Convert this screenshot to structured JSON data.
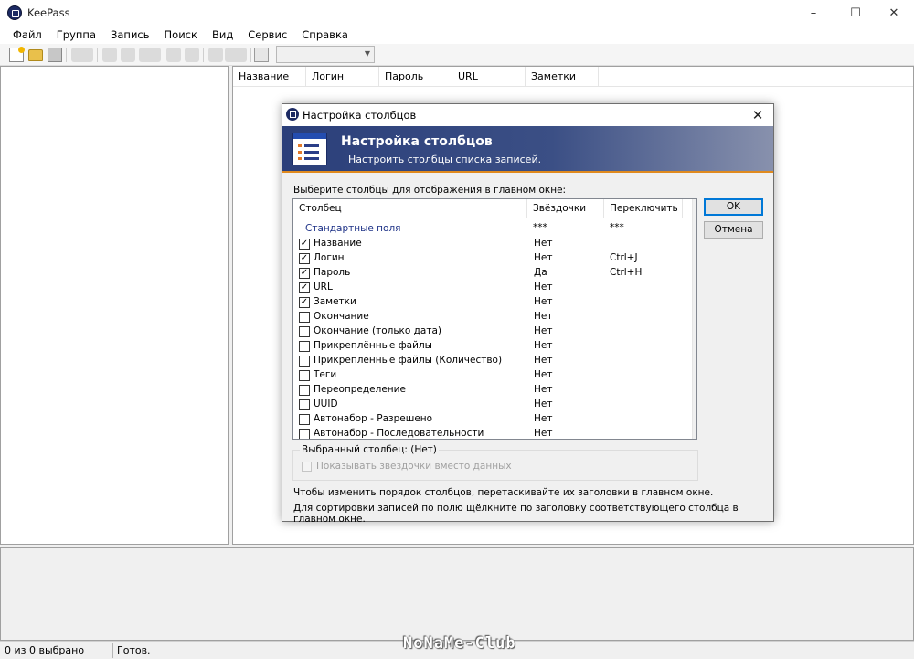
{
  "window": {
    "title": "KeePass"
  },
  "menu": [
    "Файл",
    "Группа",
    "Запись",
    "Поиск",
    "Вид",
    "Сервис",
    "Справка"
  ],
  "list_columns": [
    "Название",
    "Логин",
    "Пароль",
    "URL",
    "Заметки"
  ],
  "status": {
    "selection": "0 из 0 выбрано",
    "state": "Готов."
  },
  "watermark": "NoNaMe-Club",
  "dialog": {
    "title": "Настройка столбцов",
    "banner_title": "Настройка столбцов",
    "banner_subtitle": "Настроить столбцы списка записей.",
    "label": "Выберите столбцы для отображения в главном окне:",
    "headers": {
      "column": "Столбец",
      "stars": "Звёздочки ***",
      "toggle": "Переключить ***"
    },
    "group": "Стандартные поля",
    "rows": [
      {
        "name": "Название",
        "checked": true,
        "stars": "Нет",
        "toggle": ""
      },
      {
        "name": "Логин",
        "checked": true,
        "stars": "Нет",
        "toggle": "Ctrl+J"
      },
      {
        "name": "Пароль",
        "checked": true,
        "stars": "Да",
        "toggle": "Ctrl+H"
      },
      {
        "name": "URL",
        "checked": true,
        "stars": "Нет",
        "toggle": ""
      },
      {
        "name": "Заметки",
        "checked": true,
        "stars": "Нет",
        "toggle": ""
      },
      {
        "name": "Окончание",
        "checked": false,
        "stars": "Нет",
        "toggle": ""
      },
      {
        "name": "Окончание (только дата)",
        "checked": false,
        "stars": "Нет",
        "toggle": ""
      },
      {
        "name": "Прикреплённые файлы",
        "checked": false,
        "stars": "Нет",
        "toggle": ""
      },
      {
        "name": "Прикреплённые файлы (Количество)",
        "checked": false,
        "stars": "Нет",
        "toggle": ""
      },
      {
        "name": "Теги",
        "checked": false,
        "stars": "Нет",
        "toggle": ""
      },
      {
        "name": "Переопределение",
        "checked": false,
        "stars": "Нет",
        "toggle": ""
      },
      {
        "name": "UUID",
        "checked": false,
        "stars": "Нет",
        "toggle": ""
      },
      {
        "name": "Автонабор - Разрешено",
        "checked": false,
        "stars": "Нет",
        "toggle": ""
      },
      {
        "name": "Автонабор - Последовательности",
        "checked": false,
        "stars": "Нет",
        "toggle": ""
      }
    ],
    "ok": "OK",
    "cancel": "Отмена",
    "selected_column": "Выбранный столбец: (Нет)",
    "show_stars": "Показывать звёздочки вместо данных",
    "note_order": "Чтобы изменить порядок столбцов, перетаскивайте их заголовки в главном окне.",
    "note_sort": "Для сортировки записей по полю щёлкните по заголовку соответствующего столбца в главном окне."
  }
}
